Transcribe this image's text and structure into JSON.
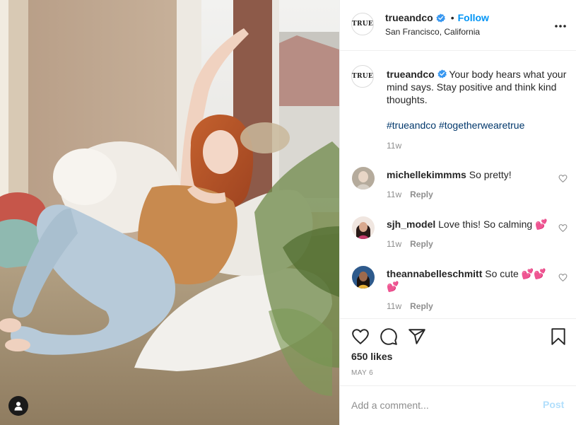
{
  "post": {
    "account": {
      "username": "trueandco",
      "avatar_text": "TRUE",
      "verified": true,
      "location": "San Francisco, California",
      "follow_label": "Follow",
      "separator": "•"
    },
    "caption": {
      "username": "trueandco",
      "text": "Your body hears what your mind says. Stay positive and think kind thoughts.",
      "hashtags": [
        "#trueandco",
        "#togetherwearetrue"
      ],
      "time": "11w"
    },
    "comments": [
      {
        "username": "michellekimmms",
        "text": "So pretty!",
        "time": "11w",
        "reply_label": "Reply"
      },
      {
        "username": "sjh_model",
        "text": "Love this! So calming 💕",
        "time": "11w",
        "reply_label": "Reply"
      },
      {
        "username": "theannabelleschmitt",
        "text": "So cute 💕💕💕",
        "time": "11w",
        "reply_label": "Reply"
      }
    ],
    "likes": "650 likes",
    "date": "MAY 6",
    "add_comment": {
      "placeholder": "Add a comment...",
      "post_label": "Post"
    },
    "icons": [
      "more-options-icon",
      "like-icon",
      "comment-icon",
      "share-icon",
      "save-icon",
      "comment-like-icon",
      "user-tag-icon",
      "verified-badge-icon"
    ],
    "colors": {
      "link": "#0095f6",
      "hashtag": "#00376b",
      "verified": "#3897f0",
      "muted": "#8e8e8e",
      "post_disabled": "#b2dffc"
    }
  }
}
